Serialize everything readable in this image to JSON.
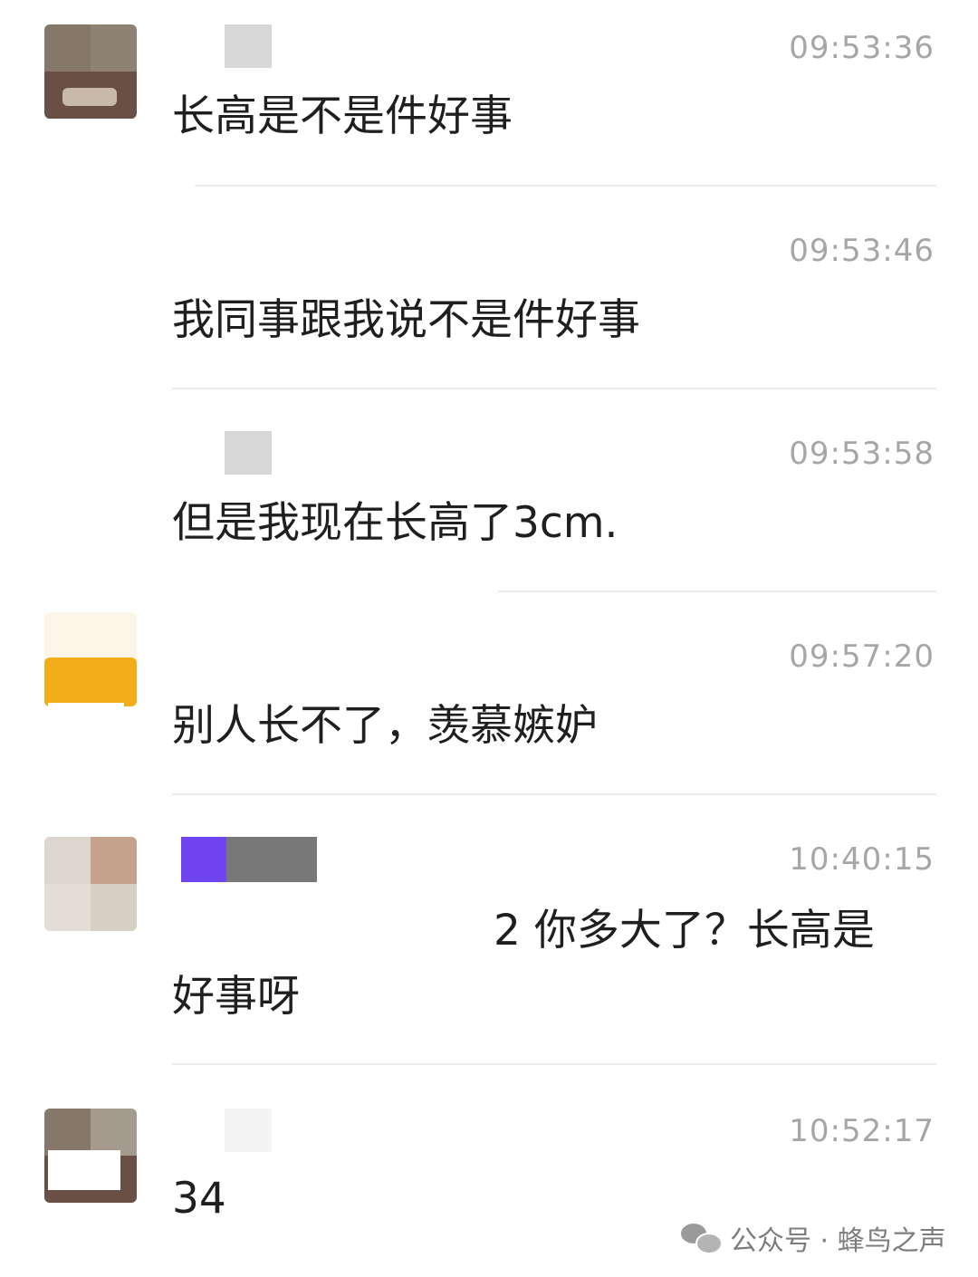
{
  "messages": [
    {
      "time": "09:53:36",
      "text": "长高是不是件好事"
    },
    {
      "time": "09:53:46",
      "text": "我同事跟我说不是件好事"
    },
    {
      "time": "09:53:58",
      "text": "但是我现在长高了3cm."
    },
    {
      "time": "09:57:20",
      "text": "别人长不了，羡慕嫉妒"
    },
    {
      "time": "10:40:15",
      "text_line1": "2 你多大了？长高是",
      "text_line2": "好事呀"
    },
    {
      "time": "10:52:17",
      "text": "34"
    }
  ],
  "watermark": {
    "text": "公众号 · 蜂鸟之声",
    "icon": "wechat-icon"
  }
}
